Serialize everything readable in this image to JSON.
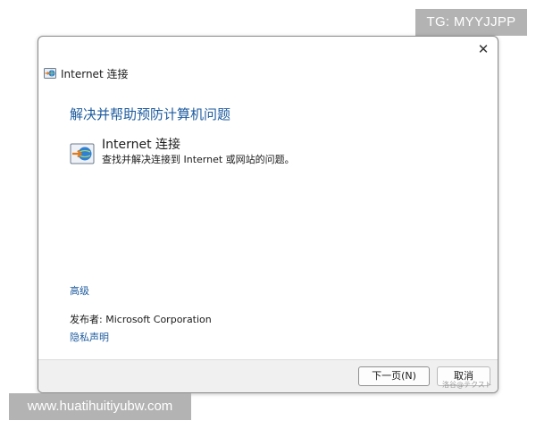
{
  "watermark_top": "TG: MYYJJPP",
  "watermark_bottom": "www.huatihuitiyubw.com",
  "window": {
    "title": "Internet 连接",
    "close_glyph": "✕"
  },
  "main": {
    "heading": "解决并帮助预防计算机问题",
    "item": {
      "icon": "network-globe-icon",
      "title": "Internet 连接",
      "description": "查找并解决连接到 Internet 或网站的问题。"
    },
    "advanced_link": "高级",
    "publisher_label": "发布者:",
    "publisher_value": "Microsoft Corporation",
    "privacy_link": "隐私声明"
  },
  "footer": {
    "next_button": "下一页(N)",
    "cancel_button": "取消",
    "corner_mark": "洛谷@テクスト"
  }
}
